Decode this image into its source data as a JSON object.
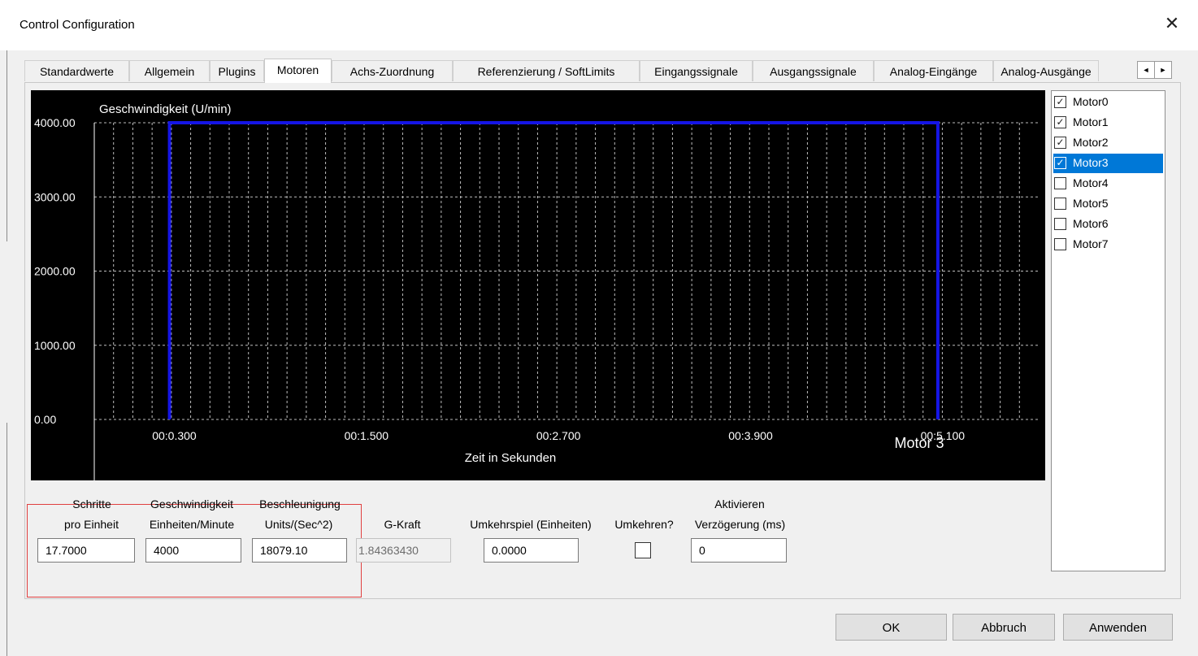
{
  "window": {
    "title": "Control Configuration",
    "close_glyph": "✕"
  },
  "tabs": [
    {
      "label": "Standardwerte",
      "active": false
    },
    {
      "label": "Allgemein",
      "active": false
    },
    {
      "label": "Plugins",
      "active": false
    },
    {
      "label": "Motoren",
      "active": true
    },
    {
      "label": "Achs-Zuordnung",
      "active": false
    },
    {
      "label": "Referenzierung / SoftLimits",
      "active": false
    },
    {
      "label": "Eingangssignale",
      "active": false
    },
    {
      "label": "Ausgangssignale",
      "active": false
    },
    {
      "label": "Analog-Eingänge",
      "active": false
    },
    {
      "label": "Analog-Ausgänge",
      "active": false
    }
  ],
  "tab_scroll": {
    "left_glyph": "◄",
    "right_glyph": "►"
  },
  "chart_data": {
    "type": "line",
    "title": "Geschwindigkeit (U/min)",
    "xlabel": "Zeit in Sekunden",
    "ylabel": "Geschwindigkeit (U/min)",
    "series_label": "Motor 3",
    "y_ticks": [
      "4000.00",
      "3000.00",
      "2000.00",
      "1000.00",
      "0.00"
    ],
    "ylim": [
      0,
      4000
    ],
    "x_ticks": [
      "00:0.300",
      "00:1.500",
      "00:2.700",
      "00:3.900",
      "00:5.100"
    ],
    "xlim": [
      -0.2,
      5.7
    ],
    "grid": true,
    "line_color": "#1515e6",
    "series": [
      {
        "name": "Motor 3",
        "x": [
          0.27,
          0.27,
          5.07,
          5.07
        ],
        "y": [
          0,
          4000,
          4000,
          0
        ]
      }
    ]
  },
  "motors": [
    {
      "label": "Motor0",
      "checked": true,
      "selected": false
    },
    {
      "label": "Motor1",
      "checked": true,
      "selected": false
    },
    {
      "label": "Motor2",
      "checked": true,
      "selected": false
    },
    {
      "label": "Motor3",
      "checked": true,
      "selected": true
    },
    {
      "label": "Motor4",
      "checked": false,
      "selected": false
    },
    {
      "label": "Motor5",
      "checked": false,
      "selected": false
    },
    {
      "label": "Motor6",
      "checked": false,
      "selected": false
    },
    {
      "label": "Motor7",
      "checked": false,
      "selected": false
    }
  ],
  "form": {
    "steps_header": "Schritte",
    "steps_label": "pro Einheit",
    "steps_value": "17.7000",
    "velocity_header": "Geschwindigkeit",
    "velocity_label": "Einheiten/Minute",
    "velocity_value": "4000",
    "accel_header": "Beschleunigung",
    "accel_label": "Units/(Sec^2)",
    "accel_value": "18079.10",
    "gforce_label": "G-Kraft",
    "gforce_value": "1.84363430",
    "backlash_label": "Umkehrspiel (Einheiten)",
    "backlash_value": "0.0000",
    "reverse_label": "Umkehren?",
    "reverse_checked": false,
    "enable_header": "Aktivieren",
    "enable_label": "Verzögerung (ms)",
    "enable_value": "0"
  },
  "buttons": {
    "ok": "OK",
    "cancel": "Abbruch",
    "apply": "Anwenden"
  },
  "colors": {
    "chart_bg": "#000000",
    "selection": "#0078d7",
    "highlight_box": "#e04040"
  }
}
